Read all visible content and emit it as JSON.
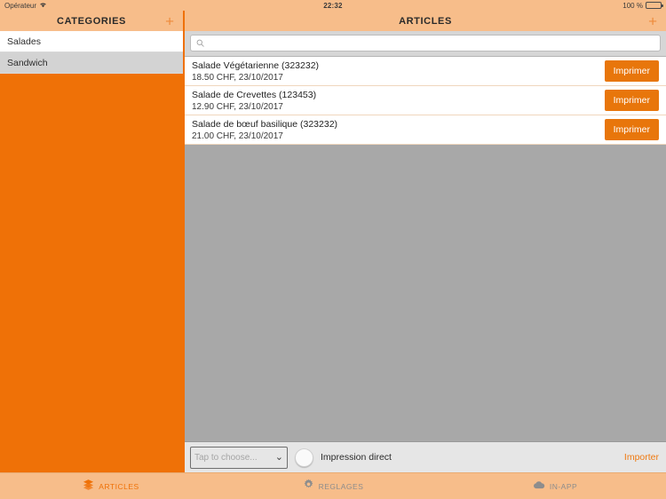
{
  "statusbar": {
    "carrier": "Opérateur",
    "wifi_icon": "wifi-icon",
    "time": "22:32",
    "battery_label": "100 %",
    "battery_icon": "battery-icon",
    "battery_level": 100,
    "background_color": "#f7bd8a"
  },
  "sidebar": {
    "title": "CATEGORIES",
    "add_icon": "plus-icon",
    "background_color": "#ef7107",
    "items": [
      {
        "label": "Salades",
        "selected": false
      },
      {
        "label": "Sandwich",
        "selected": true
      }
    ]
  },
  "main": {
    "title": "ARTICLES",
    "add_icon": "plus-icon",
    "accent_color": "#e8760b",
    "list_background_color": "#a8a8a8",
    "search": {
      "icon": "search-icon",
      "value": "",
      "placeholder": ""
    },
    "articles": [
      {
        "name": "Salade Végétarienne (323232)",
        "details": "18.50 CHF, 23/10/2017",
        "price": "18.50 CHF",
        "date": "23/10/2017",
        "code": "323232",
        "button_label": "Imprimer"
      },
      {
        "name": "Salade de Crevettes (123453)",
        "details": "12.90 CHF, 23/10/2017",
        "price": "12.90 CHF",
        "date": "23/10/2017",
        "code": "123453",
        "button_label": "Imprimer"
      },
      {
        "name": "Salade de bœuf basilique (323232)",
        "details": "21.00 CHF, 23/10/2017",
        "price": "21.00 CHF",
        "date": "23/10/2017",
        "code": "323232",
        "button_label": "Imprimer"
      }
    ]
  },
  "action_bar": {
    "select_placeholder": "Tap to choose...",
    "select_value": "",
    "chevron_icon": "chevron-down-icon",
    "toggle_label": "Impression direct",
    "toggle_state": "off",
    "import_label": "Importer"
  },
  "tabbar": {
    "tabs": [
      {
        "label": "ARTICLES",
        "icon": "layers-icon",
        "active": true
      },
      {
        "label": "REGLAGES",
        "icon": "gear-icon",
        "active": false
      },
      {
        "label": "IN-APP",
        "icon": "cloud-icon",
        "active": false
      }
    ]
  }
}
